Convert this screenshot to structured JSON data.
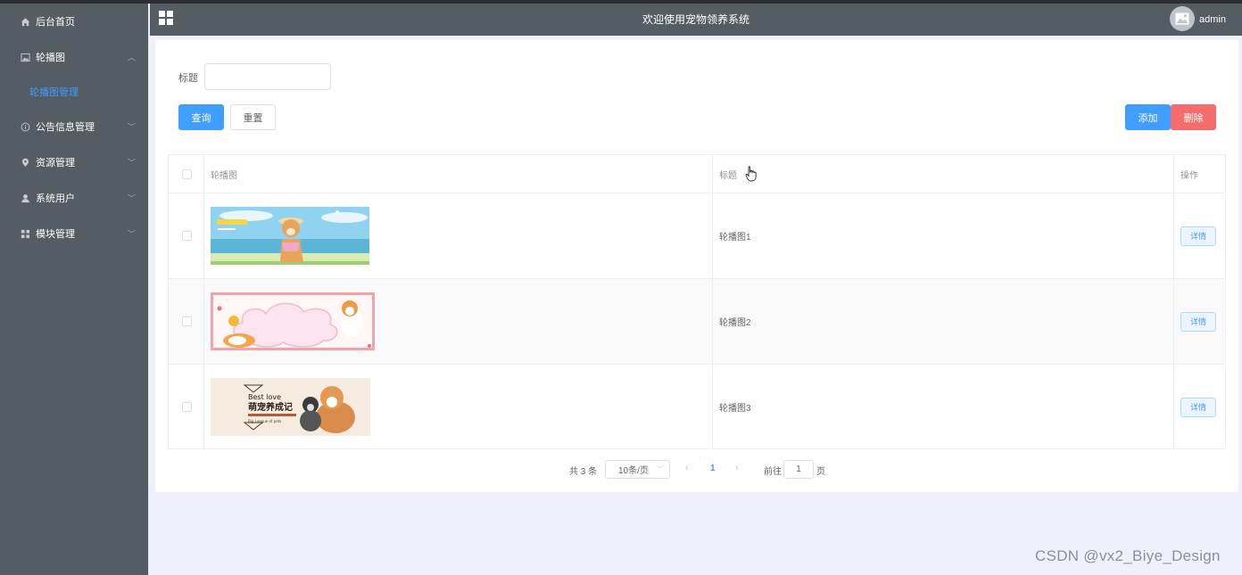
{
  "colors": {
    "accent": "#409eff",
    "danger": "#f56c6c",
    "sidebar": "#545c64"
  },
  "sidebar": {
    "items": [
      {
        "label": "后台首页",
        "icon": "home-icon",
        "expandable": false
      },
      {
        "label": "轮播图",
        "icon": "picture-icon",
        "expandable": true,
        "expanded": true,
        "children": [
          {
            "label": "轮播图管理",
            "active": true
          }
        ]
      },
      {
        "label": "公告信息管理",
        "icon": "info-icon",
        "expandable": true
      },
      {
        "label": "资源管理",
        "icon": "location-icon",
        "expandable": true
      },
      {
        "label": "系统用户",
        "icon": "user-icon",
        "expandable": true
      },
      {
        "label": "模块管理",
        "icon": "grid-icon",
        "expandable": true
      }
    ]
  },
  "header": {
    "title": "欢迎使用宠物领养系统",
    "user": "admin"
  },
  "search": {
    "label": "标题",
    "value": "",
    "query_label": "查询",
    "reset_label": "重置"
  },
  "actions": {
    "add_label": "添加",
    "delete_label": "删除"
  },
  "table": {
    "columns": [
      "轮播图",
      "标题",
      "操作"
    ],
    "rows": [
      {
        "title": "轮播图1",
        "detail_label": "详情"
      },
      {
        "title": "轮播图2",
        "detail_label": "详情"
      },
      {
        "title": "轮播图3",
        "detail_label": "详情",
        "banner_text": {
          "line1": "Best love",
          "line2": "萌宠养成记",
          "line3": "Big League of pets"
        }
      }
    ]
  },
  "pagination": {
    "total": "共 3 条",
    "page_size": "10条/页",
    "current_page": "1",
    "goto_label": "前往",
    "goto_value": "1",
    "page_unit": "页"
  },
  "watermark": "CSDN @vx2_Biye_Design"
}
